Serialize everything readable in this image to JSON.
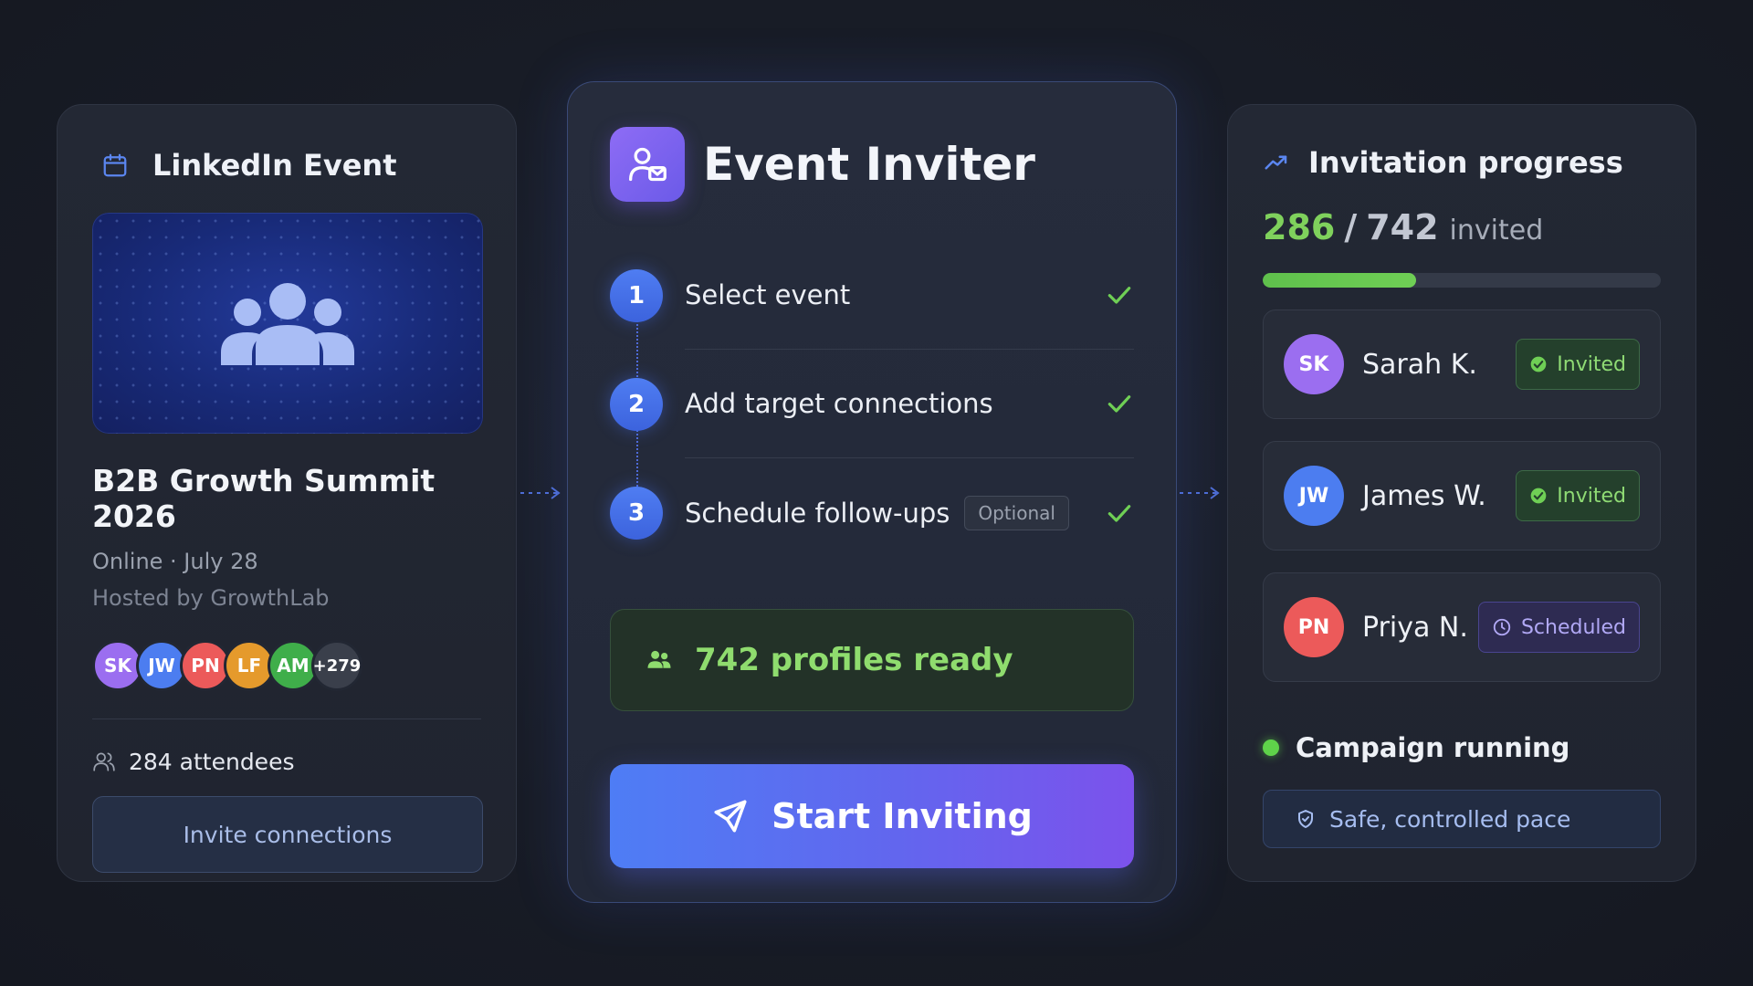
{
  "event_card": {
    "header": "LinkedIn Event",
    "title": "B2B Growth Summit 2026",
    "meta": "Online · July 28",
    "host": "Hosted by GrowthLab",
    "avatars": [
      {
        "initials": "SK",
        "color": "#9b6ef0"
      },
      {
        "initials": "JW",
        "color": "#4c7df0"
      },
      {
        "initials": "PN",
        "color": "#ec5a5a"
      },
      {
        "initials": "LF",
        "color": "#e59a2c"
      },
      {
        "initials": "AM",
        "color": "#3fae4a"
      }
    ],
    "more_count": "+279",
    "attendees": "284 attendees",
    "button": "Invite connections"
  },
  "inviter": {
    "title": "Event Inviter",
    "steps": [
      {
        "number": "1",
        "label": "Select event",
        "tag": "",
        "done": true
      },
      {
        "number": "2",
        "label": "Add target connections",
        "tag": "",
        "done": true
      },
      {
        "number": "3",
        "label": "Schedule follow-ups",
        "tag": "Optional",
        "done": true
      }
    ],
    "ready": "742 profiles ready",
    "button": "Start Inviting"
  },
  "progress": {
    "header": "Invitation progress",
    "invited": "286",
    "separator": "/",
    "total": "742",
    "word": "invited",
    "fraction": 0.385,
    "contacts": [
      {
        "initials": "SK",
        "name": "Sarah K.",
        "status": "Invited",
        "avatar_color": "#9b6ef0"
      },
      {
        "initials": "JW",
        "name": "James W.",
        "status": "Invited",
        "avatar_color": "#4c7df0"
      },
      {
        "initials": "PN",
        "name": "Priya N.",
        "status": "Scheduled",
        "avatar_color": "#ec5a5a"
      }
    ],
    "campaign": "Campaign running",
    "pace": "Safe, controlled pace"
  },
  "colors": {
    "accent_blue": "#4f7df2",
    "accent_purple": "#7c52ec",
    "success_green": "#7fd15c"
  }
}
